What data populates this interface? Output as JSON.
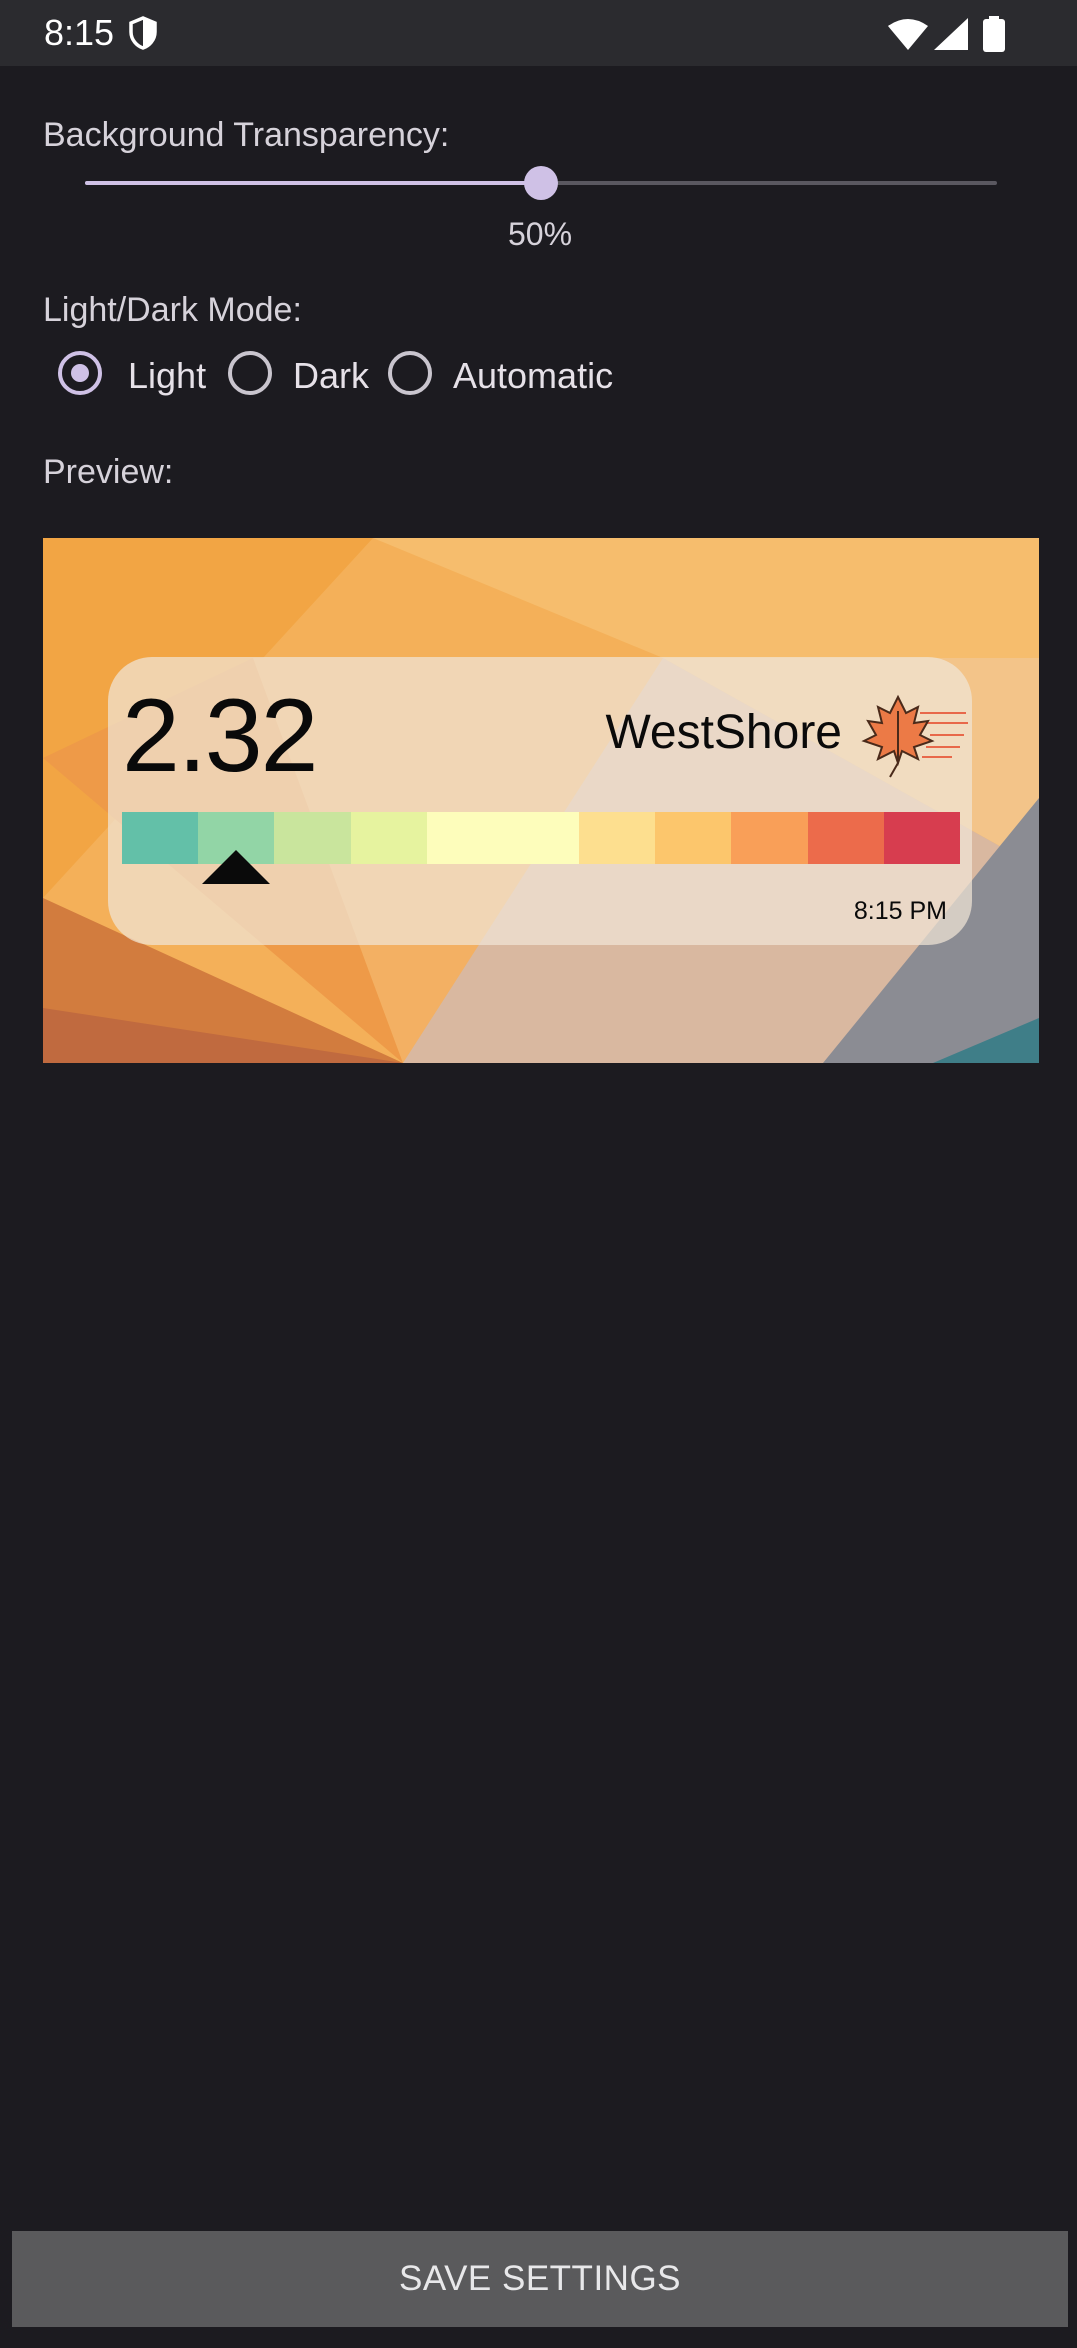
{
  "status_bar": {
    "time": "8:15",
    "icons": [
      "shield-icon",
      "wifi-icon",
      "signal-icon",
      "battery-icon"
    ]
  },
  "transparency": {
    "label": "Background Transparency:",
    "value_text": "50%",
    "value": 0.5
  },
  "mode": {
    "label": "Light/Dark Mode:",
    "options": [
      {
        "label": "Light",
        "checked": true
      },
      {
        "label": "Dark",
        "checked": false
      },
      {
        "label": "Automatic",
        "checked": false
      }
    ]
  },
  "preview": {
    "label": "Preview:",
    "widget": {
      "value": "2.32",
      "location": "WestShore",
      "time": "8:15 PM",
      "scale_colors": [
        "#63c0a8",
        "#92d5a6",
        "#c9e59d",
        "#e6f39f",
        "#fdfdbb",
        "#fdfdbb",
        "#fddf8f",
        "#fcc66c",
        "#f99f58",
        "#ec6b4b",
        "#d73d4f"
      ],
      "pointer_segment": 1,
      "icon": "maple-leaf-icon"
    }
  },
  "save_button": {
    "label": "SAVE SETTINGS"
  },
  "colors": {
    "background": "#1c1b20",
    "accent": "#cfc1e6",
    "button": "#5a5a5c"
  }
}
